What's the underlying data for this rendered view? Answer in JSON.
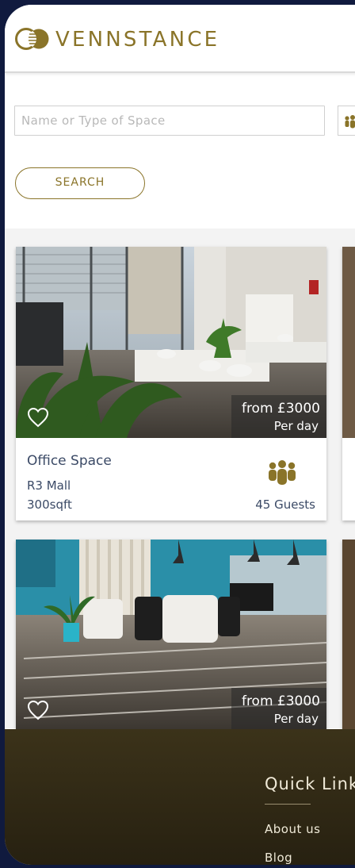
{
  "brand": {
    "name": "VENNSTANCE",
    "accent": "#8a7429"
  },
  "search": {
    "placeholder": "Name or Type of Space",
    "button_label": "SEARCH"
  },
  "listings": [
    {
      "title": "Office Space",
      "location": "R3 Mall",
      "size": "300sqft",
      "guests": "45 Guests",
      "price_from": "from £3000",
      "price_per": "Per day",
      "favorite_icon": "heart-outline-icon",
      "guests_icon": "group-people-icon"
    },
    {
      "price_from": "from £3000",
      "price_per": "Per day",
      "favorite_icon": "heart-outline-icon"
    }
  ],
  "footer": {
    "heading": "Quick Link",
    "links": [
      "About us",
      "Blog"
    ]
  }
}
